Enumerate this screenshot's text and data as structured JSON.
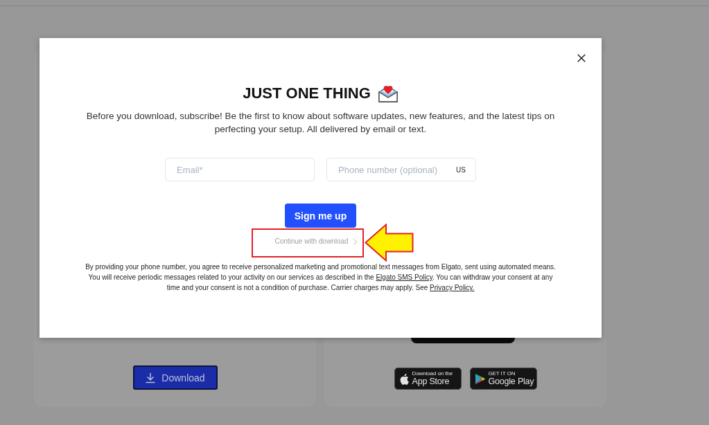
{
  "modal": {
    "title": "JUST ONE THING",
    "description": "Before you download, subscribe! Be the first to know about software updates, new features, and the latest tips on perfecting your setup. All delivered by email or text.",
    "fields": [
      {
        "kind": "email",
        "placeholder": "Email*"
      },
      {
        "kind": "phone",
        "placeholder": "Phone number (optional)",
        "country": "US"
      }
    ],
    "submit_button": "Sign me up",
    "continue_link": "Continue with download",
    "legal": [
      {
        "kind": "text",
        "text": "By providing your phone number, you agree to receive personalized marketing and promotional text messages from Elgato, sent using automated means. You will receive periodic messages related to your activity on our services as described in the "
      },
      {
        "kind": "link",
        "text": "Elgato SMS Policy"
      },
      {
        "kind": "text",
        "text": ". You can withdraw your consent at any time and your consent is not a condition of purchase. Carrier charges may apply. See "
      },
      {
        "kind": "link",
        "text": "Privacy Policy."
      }
    ]
  },
  "background_cards": [
    {
      "kind": "download",
      "button": "Download"
    },
    {
      "kind": "stores",
      "badges": [
        {
          "kind": "apple",
          "small": "Download on the",
          "large": "App Store"
        },
        {
          "kind": "google",
          "small": "GET IT ON",
          "large": "Google Play"
        }
      ]
    }
  ],
  "annotations": [
    {
      "kind": "highlight-rectangle"
    },
    {
      "kind": "arrow"
    }
  ]
}
